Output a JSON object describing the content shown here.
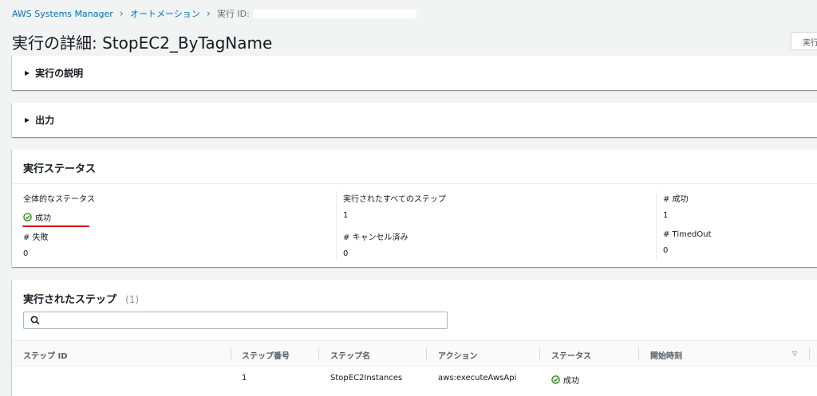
{
  "breadcrumb": {
    "items": [
      "AWS Systems Manager",
      "オートメーション",
      "実行 ID:"
    ]
  },
  "page": {
    "title": "実行の詳細: StopEC2_ByTagName",
    "top_button": "実行"
  },
  "sections": {
    "description": "実行の説明",
    "output": "出力"
  },
  "status": {
    "title": "実行ステータス",
    "overall_label": "全体的なステータス",
    "overall_value": "成功",
    "all_steps_label": "実行されたすべてのステップ",
    "all_steps_value": "1",
    "success_label": "# 成功",
    "success_value": "1",
    "failed_label": "# 失敗",
    "failed_value": "0",
    "cancelled_label": "# キャンセル済み",
    "cancelled_value": "0",
    "timedout_label": "# TimedOut",
    "timedout_value": "0"
  },
  "steps": {
    "title": "実行されたステップ",
    "count": "(1)",
    "search_placeholder": "",
    "columns": [
      "ステップ ID",
      "ステップ番号",
      "ステップ名",
      "アクション",
      "ステータス",
      "開始時刻"
    ],
    "rows": [
      {
        "step_id": "",
        "number": "1",
        "name": "StopEC2Instances",
        "action": "aws:executeAwsApi",
        "status": "成功"
      }
    ]
  },
  "colors": {
    "link": "#0073bb",
    "success": "#1d8102",
    "highlight": "#e00000"
  },
  "icons": [
    "chevron-right-icon",
    "caret-right-icon",
    "check-circle-icon",
    "search-icon",
    "sort-down-icon"
  ]
}
